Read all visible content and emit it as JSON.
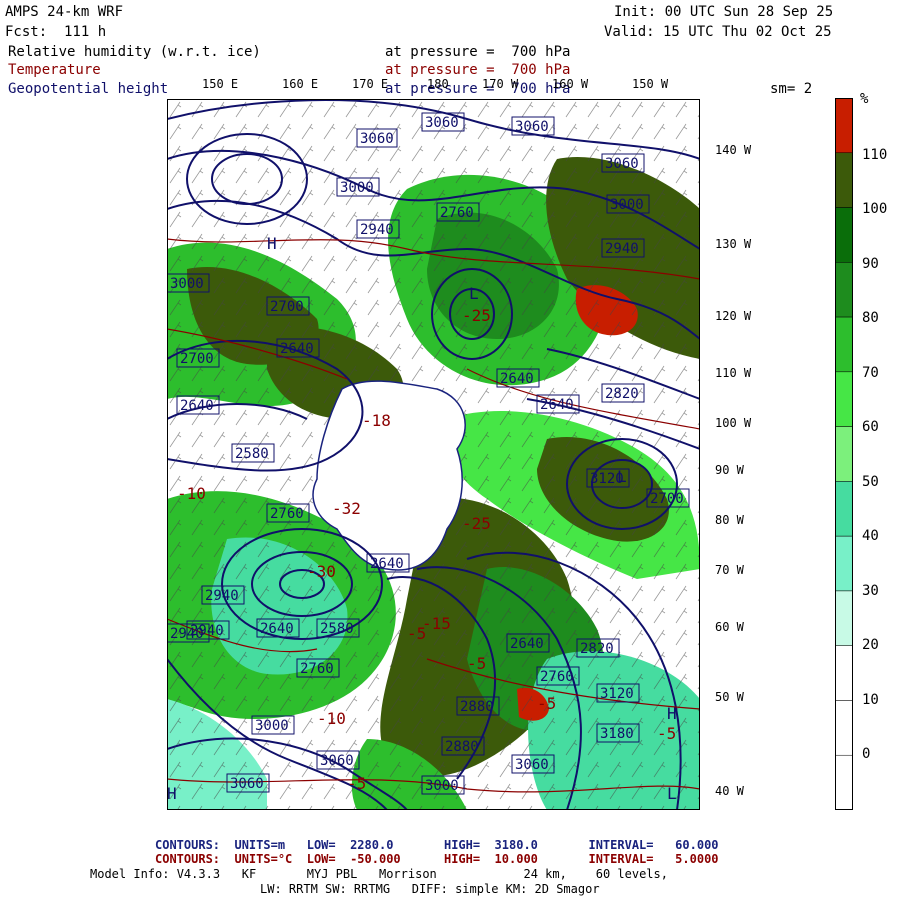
{
  "header": {
    "model": "AMPS 24-km WRF",
    "forecast": "Fcst:  111 h",
    "init": "Init: 00 UTC Sun 28 Sep 25",
    "valid": "Valid: 15 UTC Thu 02 Oct 25"
  },
  "fields": [
    {
      "name": "Relative humidity (w.r.t. ice)",
      "level": "at pressure =  700 hPa"
    },
    {
      "name": "Temperature",
      "level": "at pressure =  700 hPa"
    },
    {
      "name": "Geopotential height",
      "level": "at pressure =  700 hPa"
    }
  ],
  "smoothing": "sm= 2",
  "lon_labels_top": [
    "150 E",
    "160 E",
    "170 E",
    "180",
    "170 W",
    "160 W",
    "150 W"
  ],
  "lat_labels_right": [
    "140 W",
    "130 W",
    "120 W",
    "110 W",
    "100 W",
    "90 W",
    "80 W",
    "70 W",
    "60 W",
    "50 W",
    "40 W"
  ],
  "colorbar": {
    "unit": "%",
    "labels": [
      "110",
      "100",
      "90",
      "80",
      "70",
      "60",
      "50",
      "40",
      "30",
      "20",
      "10",
      "0"
    ],
    "colors": [
      "#c81e00",
      "#3c5a0a",
      "#0a6e0a",
      "#1e8c1e",
      "#2dbe2d",
      "#46e646",
      "#7cf07c",
      "#46dca0",
      "#78f0c8",
      "#c8fae6",
      "#ffffff",
      "#ffffff",
      "#ffffff"
    ]
  },
  "map_labels": {
    "heights": [
      "3060",
      "3060",
      "3060",
      "3000",
      "2940",
      "3060",
      "3000",
      "2760",
      "2940",
      "3000",
      "2700",
      "2700",
      "2640",
      "2820",
      "2640",
      "2580",
      "2640",
      "2640",
      "2580",
      "2760",
      "2940",
      "2640",
      "2760",
      "2820",
      "3120",
      "3000",
      "3060",
      "3000",
      "3180",
      "3060",
      "2880",
      "2880",
      "2940",
      "2940",
      "3060",
      "3120",
      "2760",
      "2640",
      "2640",
      "2700"
    ],
    "temps": [
      "-18",
      "-32",
      "-25",
      "-25",
      "-30",
      "-15",
      "-10",
      "-5",
      "-5",
      "-5",
      "-5",
      "-5",
      "-10"
    ],
    "lows": [
      "L",
      "L",
      "L"
    ],
    "highs": [
      "H",
      "H",
      "H"
    ]
  },
  "footer": {
    "line1": "CONTOURS:  UNITS=m   LOW=  2280.0       HIGH=  3180.0       INTERVAL=   60.000",
    "line2": "CONTOURS:  UNITS=°C  LOW=  -50.000      HIGH=  10.000       INTERVAL=   5.0000",
    "line3": "Model Info: V4.3.3   KF       MYJ PBL   Morrison            24 km,    60 levels,",
    "line4": "LW: RRTM SW: RRTMG   DIFF: simple KM: 2D Smagor"
  }
}
